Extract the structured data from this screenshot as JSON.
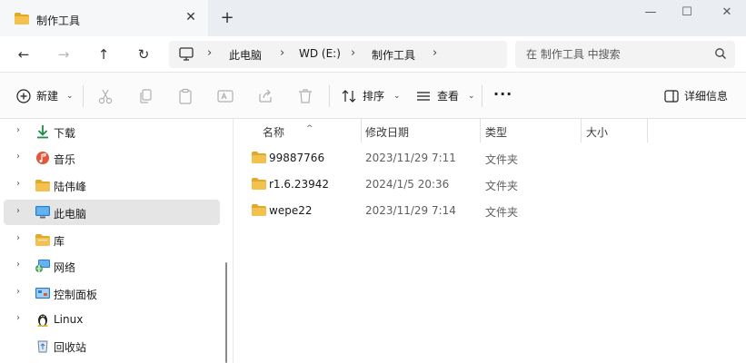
{
  "tab": {
    "title": "制作工具",
    "close": "✕",
    "new_tab": "+"
  },
  "window": {
    "minimize": "—",
    "maximize": "☐",
    "close": "✕"
  },
  "nav": {
    "back": "←",
    "forward": "→",
    "up": "↑",
    "refresh": "↻"
  },
  "breadcrumb": {
    "sep": "›",
    "items": [
      "此电脑",
      "WD (E:)",
      "制作工具"
    ]
  },
  "search": {
    "placeholder": "在 制作工具 中搜索"
  },
  "toolbar": {
    "new_label": "新建",
    "sort_label": "排序",
    "view_label": "查看",
    "more": "···",
    "details_label": "详细信息",
    "chevron": "⌄"
  },
  "sidebar": {
    "expander": "›",
    "items": [
      {
        "label": "下载",
        "icon": "download-icon"
      },
      {
        "label": "音乐",
        "icon": "music-icon"
      },
      {
        "label": "陆伟峰",
        "icon": "user-folder-icon"
      },
      {
        "label": "此电脑",
        "icon": "this-pc-icon",
        "selected": true
      },
      {
        "label": "库",
        "icon": "library-icon"
      },
      {
        "label": "网络",
        "icon": "network-icon"
      },
      {
        "label": "控制面板",
        "icon": "control-panel-icon"
      },
      {
        "label": "Linux",
        "icon": "linux-icon"
      },
      {
        "label": "回收站",
        "icon": "recycle-bin-icon"
      }
    ]
  },
  "columns": {
    "name": "名称",
    "modified": "修改日期",
    "type": "类型",
    "size": "大小",
    "sort_indicator": "^"
  },
  "files": [
    {
      "name": "99887766",
      "modified": "2023/11/29 7:11",
      "type": "文件夹",
      "size": ""
    },
    {
      "name": "r1.6.23942",
      "modified": "2024/1/5 20:36",
      "type": "文件夹",
      "size": ""
    },
    {
      "name": "wepe22",
      "modified": "2023/11/29 7:14",
      "type": "文件夹",
      "size": ""
    }
  ],
  "colors": {
    "folder": "#f2c14e",
    "folder_dark": "#e0a92a",
    "selected": "#e5e5e5",
    "accent": "#0067c0"
  }
}
